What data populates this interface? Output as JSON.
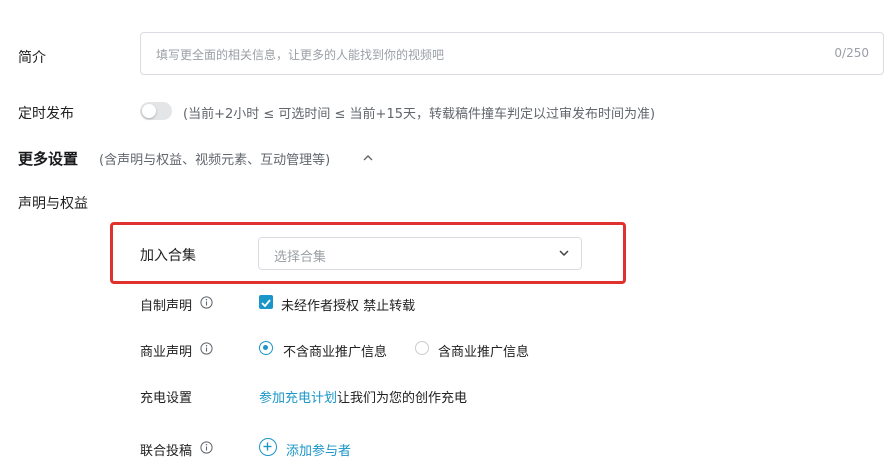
{
  "description": {
    "label": "简介",
    "placeholder": "填写更全面的相关信息，让更多的人能找到你的视频吧",
    "counter": "0/250"
  },
  "schedule": {
    "label": "定时发布",
    "toggle_on": false,
    "hint": "(当前+2小时 ≤ 可选时间 ≤ 当前+15天，转载稿件撞车判定以过审发布时间为准)"
  },
  "more_settings": {
    "title": "更多设置",
    "subtitle": "(含声明与权益、视频元素、互动管理等)"
  },
  "rights": {
    "section_label": "声明与权益",
    "collection": {
      "label": "加入合集",
      "placeholder": "选择合集"
    },
    "self_made": {
      "label": "自制声明",
      "checkbox_label": "未经作者授权 禁止转载",
      "checked": true
    },
    "commercial": {
      "label": "商业声明",
      "options": [
        "不含商业推广信息",
        "含商业推广信息"
      ],
      "selected_index": 0
    },
    "charge": {
      "label": "充电设置",
      "link": "参加充电计划",
      "text": "让我们为您的创作充电"
    },
    "co_post": {
      "label": "联合投稿",
      "add_label": "添加参与者"
    }
  },
  "colors": {
    "accent": "#1a96c8",
    "highlight": "#e0312f"
  }
}
